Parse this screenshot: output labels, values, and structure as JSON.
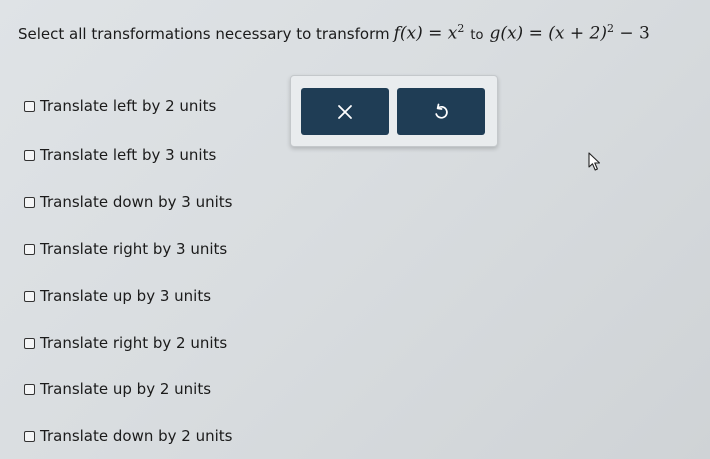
{
  "question": {
    "prompt": "Select all transformations necessary to transform",
    "f_expr": "f(x) = x",
    "f_exp": "2",
    "to_word": "to",
    "g_expr": "g(x) = (x + 2)",
    "g_exp": "2",
    "g_tail": " − 3"
  },
  "toolbar": {
    "clear_icon": "close-icon",
    "undo_icon": "undo-icon"
  },
  "options": [
    {
      "label": "Translate left by 2 units",
      "checked": false
    },
    {
      "label": "Translate left by 3 units",
      "checked": false
    },
    {
      "label": "Translate down by 3 units",
      "checked": false
    },
    {
      "label": "Translate right by 3 units",
      "checked": false
    },
    {
      "label": "Translate up by 3 units",
      "checked": false
    },
    {
      "label": "Translate right by 2 units",
      "checked": false
    },
    {
      "label": "Translate up by 2 units",
      "checked": false
    },
    {
      "label": "Translate down by 2 units",
      "checked": false
    }
  ],
  "colors": {
    "toolbar_button": "#1f3d55",
    "background": "#dcdfe2"
  }
}
